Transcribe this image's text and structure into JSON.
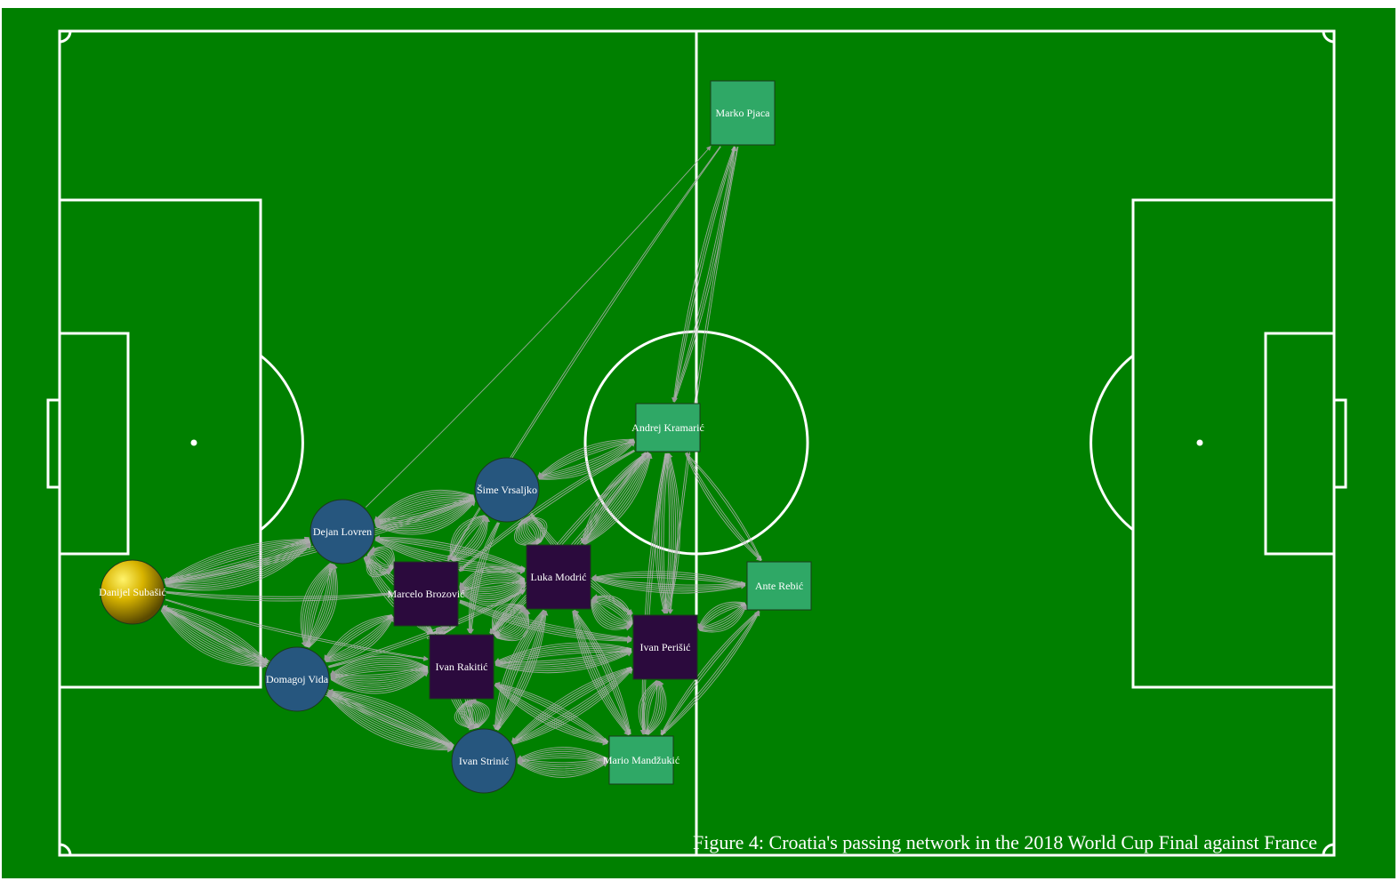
{
  "caption": "Figure 4: Croatia's passing network in the 2018 World Cup Final against France",
  "colors": {
    "pitch": "#008000",
    "lines": "#ffffff",
    "edge": "#b0b0b0",
    "arrow": "#9a9a9a",
    "goalkeeper": "#e6c200",
    "defender": "#26567e",
    "midfielder": "#2b0a3d",
    "forward": "#2fa866",
    "node_border": "#1b3a1b"
  },
  "players": {
    "subasic": {
      "label": "Danijel Subašić",
      "role": "goalkeeper",
      "shape": "sphere"
    },
    "lovren": {
      "label": "Dejan Lovren",
      "role": "defender",
      "shape": "circle"
    },
    "vrsaljko": {
      "label": "Šime Vrsaljko",
      "role": "defender",
      "shape": "circle"
    },
    "vida": {
      "label": "Domagoj Vida",
      "role": "defender",
      "shape": "circle"
    },
    "strinic": {
      "label": "Ivan Strinić",
      "role": "defender",
      "shape": "circle"
    },
    "brozovic": {
      "label": "Marcelo Brozović",
      "role": "midfielder",
      "shape": "square"
    },
    "modric": {
      "label": "Luka Modrić",
      "role": "midfielder",
      "shape": "square"
    },
    "rakitic": {
      "label": "Ivan Rakitić",
      "role": "midfielder",
      "shape": "square"
    },
    "perisic": {
      "label": "Ivan Perišić",
      "role": "midfielder",
      "shape": "square"
    },
    "pjaca": {
      "label": "Marko Pjaca",
      "role": "forward",
      "shape": "square"
    },
    "kramaric": {
      "label": "Andrej Kramarić",
      "role": "forward",
      "shape": "square"
    },
    "rebic": {
      "label": "Ante Rebić",
      "role": "forward",
      "shape": "square"
    },
    "mandzukic": {
      "label": "Mario Mandžukić",
      "role": "forward",
      "shape": "square"
    }
  },
  "passes": [
    [
      "subasic",
      "lovren",
      12
    ],
    [
      "lovren",
      "subasic",
      6
    ],
    [
      "subasic",
      "vida",
      10
    ],
    [
      "vida",
      "subasic",
      5
    ],
    [
      "subasic",
      "brozovic",
      3
    ],
    [
      "subasic",
      "vrsaljko",
      4
    ],
    [
      "subasic",
      "strinic",
      4
    ],
    [
      "subasic",
      "rakitic",
      2
    ],
    [
      "lovren",
      "vida",
      8
    ],
    [
      "vida",
      "lovren",
      7
    ],
    [
      "lovren",
      "vrsaljko",
      11
    ],
    [
      "vrsaljko",
      "lovren",
      9
    ],
    [
      "lovren",
      "brozovic",
      9
    ],
    [
      "brozovic",
      "lovren",
      7
    ],
    [
      "lovren",
      "modric",
      6
    ],
    [
      "modric",
      "lovren",
      4
    ],
    [
      "lovren",
      "rakitic",
      5
    ],
    [
      "rakitic",
      "lovren",
      4
    ],
    [
      "lovren",
      "pjaca",
      1
    ],
    [
      "vida",
      "rakitic",
      10
    ],
    [
      "rakitic",
      "vida",
      8
    ],
    [
      "vida",
      "strinic",
      9
    ],
    [
      "strinic",
      "vida",
      7
    ],
    [
      "vida",
      "brozovic",
      6
    ],
    [
      "brozovic",
      "vida",
      5
    ],
    [
      "vida",
      "modric",
      3
    ],
    [
      "vrsaljko",
      "brozovic",
      7
    ],
    [
      "brozovic",
      "vrsaljko",
      6
    ],
    [
      "vrsaljko",
      "modric",
      9
    ],
    [
      "modric",
      "vrsaljko",
      8
    ],
    [
      "vrsaljko",
      "kramaric",
      6
    ],
    [
      "kramaric",
      "vrsaljko",
      5
    ],
    [
      "vrsaljko",
      "perisic",
      4
    ],
    [
      "vrsaljko",
      "rakitic",
      4
    ],
    [
      "brozovic",
      "modric",
      10
    ],
    [
      "modric",
      "brozovic",
      9
    ],
    [
      "brozovic",
      "rakitic",
      9
    ],
    [
      "rakitic",
      "brozovic",
      8
    ],
    [
      "brozovic",
      "perisic",
      5
    ],
    [
      "brozovic",
      "strinic",
      5
    ],
    [
      "strinic",
      "brozovic",
      4
    ],
    [
      "modric",
      "rakitic",
      9
    ],
    [
      "rakitic",
      "modric",
      10
    ],
    [
      "modric",
      "perisic",
      8
    ],
    [
      "perisic",
      "modric",
      7
    ],
    [
      "modric",
      "kramaric",
      7
    ],
    [
      "kramaric",
      "modric",
      6
    ],
    [
      "modric",
      "rebic",
      5
    ],
    [
      "rebic",
      "modric",
      4
    ],
    [
      "modric",
      "mandzukic",
      5
    ],
    [
      "mandzukic",
      "modric",
      4
    ],
    [
      "modric",
      "strinic",
      6
    ],
    [
      "strinic",
      "modric",
      5
    ],
    [
      "rakitic",
      "strinic",
      9
    ],
    [
      "strinic",
      "rakitic",
      8
    ],
    [
      "rakitic",
      "perisic",
      7
    ],
    [
      "perisic",
      "rakitic",
      6
    ],
    [
      "rakitic",
      "mandzukic",
      5
    ],
    [
      "mandzukic",
      "rakitic",
      4
    ],
    [
      "rakitic",
      "kramaric",
      4
    ],
    [
      "strinic",
      "mandzukic",
      8
    ],
    [
      "mandzukic",
      "strinic",
      6
    ],
    [
      "strinic",
      "perisic",
      5
    ],
    [
      "perisic",
      "strinic",
      5
    ],
    [
      "perisic",
      "mandzukic",
      6
    ],
    [
      "mandzukic",
      "perisic",
      6
    ],
    [
      "perisic",
      "rebic",
      6
    ],
    [
      "rebic",
      "perisic",
      5
    ],
    [
      "perisic",
      "kramaric",
      6
    ],
    [
      "kramaric",
      "perisic",
      5
    ],
    [
      "kramaric",
      "pjaca",
      3
    ],
    [
      "pjaca",
      "kramaric",
      3
    ],
    [
      "pjaca",
      "perisic",
      2
    ],
    [
      "pjaca",
      "brozovic",
      2
    ],
    [
      "kramaric",
      "rebic",
      3
    ],
    [
      "rebic",
      "kramaric",
      2
    ],
    [
      "kramaric",
      "mandzukic",
      3
    ],
    [
      "kramaric",
      "brozovic",
      3
    ],
    [
      "kramaric",
      "rakitic",
      3
    ],
    [
      "rebic",
      "mandzukic",
      3
    ],
    [
      "mandzukic",
      "rebic",
      3
    ]
  ]
}
